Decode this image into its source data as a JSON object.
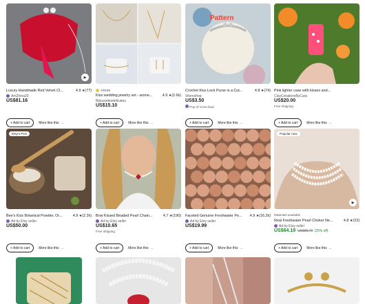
{
  "cards": [
    {
      "title": "Luxury Handmade Red Velvet Cl...",
      "rating": "4.9",
      "reviews": "(77)",
      "seller": "AmZhina20",
      "price": "US$81.16",
      "shipping": "",
      "add": "+ Add to cart",
      "more": "More like this"
    },
    {
      "title": "Kiss wedding jewelry set - wome...",
      "rating": "4.9",
      "reviews": "(2.6k)",
      "seller": "Bijouxsdesdelicates",
      "price": "US$15.10",
      "shipping": "",
      "add": "+ Add to cart",
      "more": "More like this",
      "badge": "+more"
    },
    {
      "title": "Crochet Kiss Lock Purse is a Cut...",
      "rating": "4.8",
      "reviews": "(74)",
      "seller": "Viloreshop",
      "price": "US$3.50",
      "shipping": "Pop of Crow load",
      "add": "+ Add to cart",
      "more": "More like this",
      "overlay": "Pattern"
    },
    {
      "title": "Pink lighter case with kisses and...",
      "rating": "",
      "reviews": "",
      "seller": "ClayCreationsByCara",
      "price": "US$20.00",
      "shipping": "Free shipping",
      "add": "+ Add to cart",
      "more": "More like this"
    },
    {
      "title": "Bee's Kiss Botanical Powder, Or...",
      "rating": "4.9",
      "reviews": "(2.2k)",
      "seller": "Ad by Etsy seller",
      "price": "US$50.00",
      "shipping": "",
      "add": "+ Add to cart",
      "more": "More like this",
      "badge": "Etsy's Pick"
    },
    {
      "title": "Bow Kissed Beaded Pearl Chain...",
      "rating": "4.7",
      "reviews": "(190)",
      "seller": "Ad by Etsy seller",
      "price": "US$10.65",
      "shipping": "Free shipping",
      "add": "+ Add to cart",
      "more": "More like this"
    },
    {
      "title": "Faceted Genuine Freshwater Pe...",
      "rating": "4.9",
      "reviews": "(16.2k)",
      "seller": "Ad by Etsy seller",
      "price": "US$19.99",
      "shipping": "",
      "add": "+ Add to cart",
      "more": "More like this"
    },
    {
      "title": "Real Freshwater Pearl Choker Ne...",
      "rating": "4.8",
      "reviews": "(23)",
      "seller": "Ad by Etsy seller",
      "price": "US$64.19",
      "orig": "US$85.70",
      "off": "(25% off)",
      "shipping": "",
      "add": "+ Add to cart",
      "more": "More like this",
      "badge": "Popular now",
      "note": "Materials available"
    }
  ]
}
